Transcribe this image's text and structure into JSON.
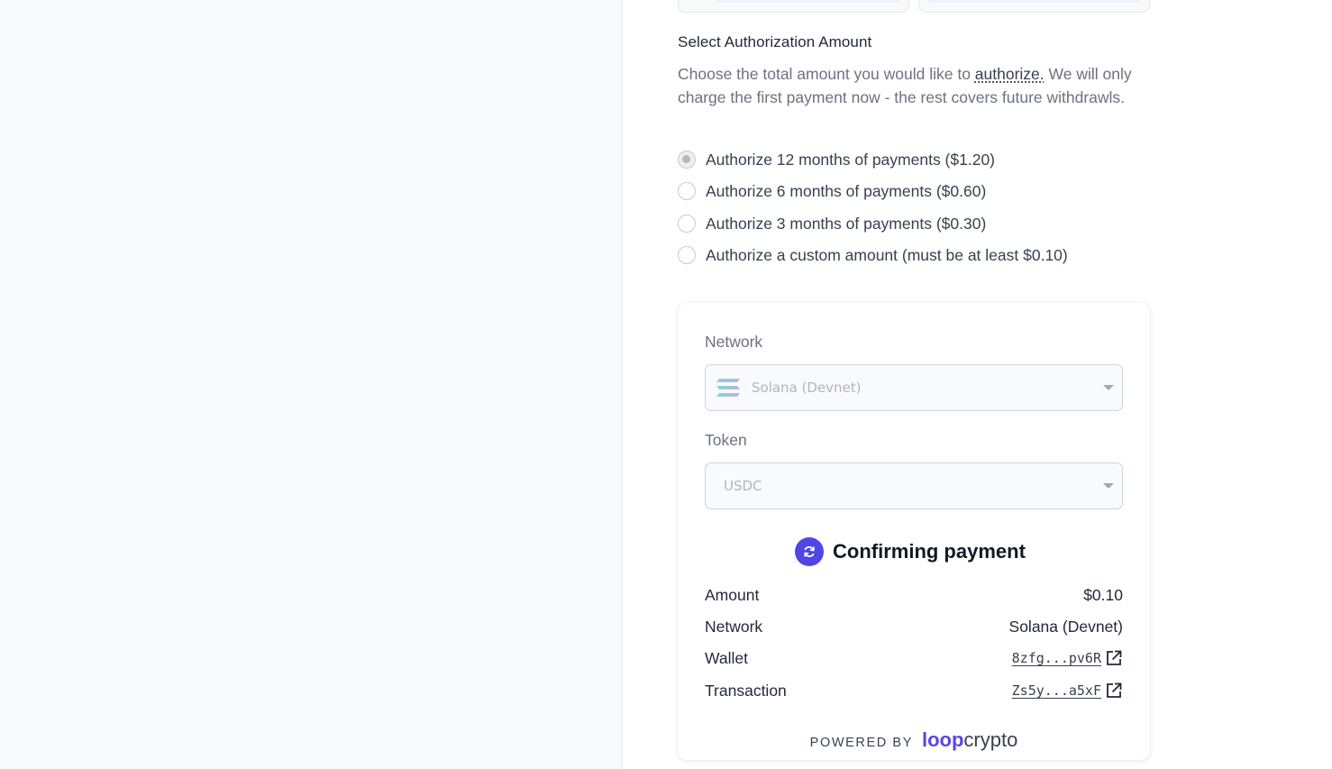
{
  "authorization": {
    "title": "Select Authorization Amount",
    "description_pre": "Choose the total amount you would like to ",
    "description_term": "authorize.",
    "description_post": " We will only charge the first payment now - the rest covers future withdrawls.",
    "options": [
      {
        "label": "Authorize 12 months of payments ($1.20)",
        "checked": true
      },
      {
        "label": "Authorize 6 months of payments ($0.60)",
        "checked": false
      },
      {
        "label": "Authorize 3 months of payments ($0.30)",
        "checked": false
      },
      {
        "label": "Authorize a custom amount (must be at least $0.10)",
        "checked": false
      }
    ]
  },
  "checkout": {
    "network_label": "Network",
    "network_value": "Solana (Devnet)",
    "token_label": "Token",
    "token_value": "USDC",
    "status": "Confirming payment",
    "details": [
      {
        "key": "Amount",
        "value": "$0.10"
      },
      {
        "key": "Network",
        "value": "Solana (Devnet)"
      },
      {
        "key": "Wallet",
        "value": "8zfg...pv6R"
      },
      {
        "key": "Transaction",
        "value": "Zs5y...a5xF"
      }
    ],
    "powered_by": "POWERED BY",
    "brand_part1": "loop",
    "brand_part2": "crypto"
  },
  "colors": {
    "accent": "#4f46e5",
    "brand": "#5b45e0",
    "left_pane_bg": "#f8f9fb"
  },
  "icons": {
    "status": "refresh-icon",
    "link": "external-link-icon",
    "network": "solana-logo-icon"
  }
}
